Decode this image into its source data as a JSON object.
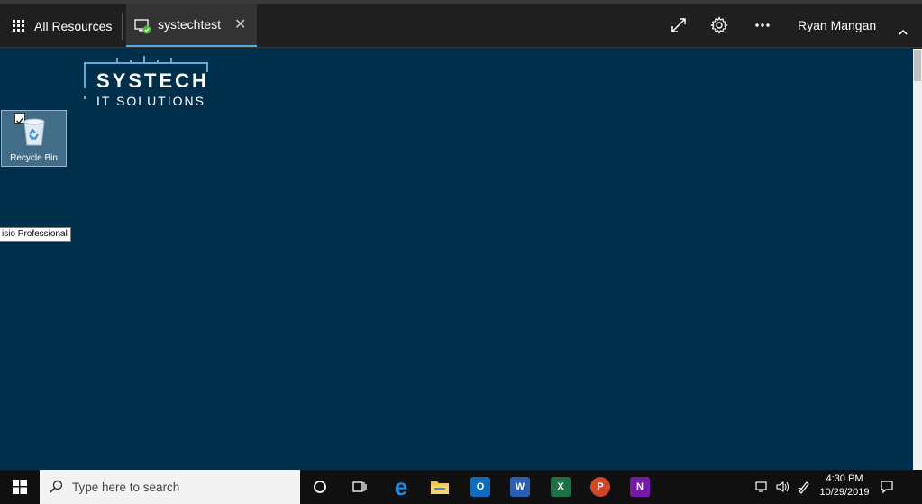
{
  "appbar": {
    "all_resources_label": "All Resources",
    "tab_label": "systechtest",
    "user_name": "Ryan Mangan"
  },
  "desktop": {
    "logo_line1": "SYSTECH",
    "logo_line2": "IT SOLUTIONS",
    "recycle_bin_label": "Recycle Bin",
    "tooltip_text": "isio Professional"
  },
  "taskbar": {
    "search_placeholder": "Type here to search",
    "time": "4:30 PM",
    "date": "10/29/2019",
    "pinned_apps": [
      "Microsoft Edge",
      "File Explorer",
      "Outlook",
      "Word",
      "Excel",
      "PowerPoint",
      "OneNote"
    ]
  },
  "colors": {
    "desktop_bg": "#002f4b",
    "appbar_bg": "#1f1f1f",
    "tab_accent": "#54a7e0",
    "connected_green": "#4cb93b"
  }
}
